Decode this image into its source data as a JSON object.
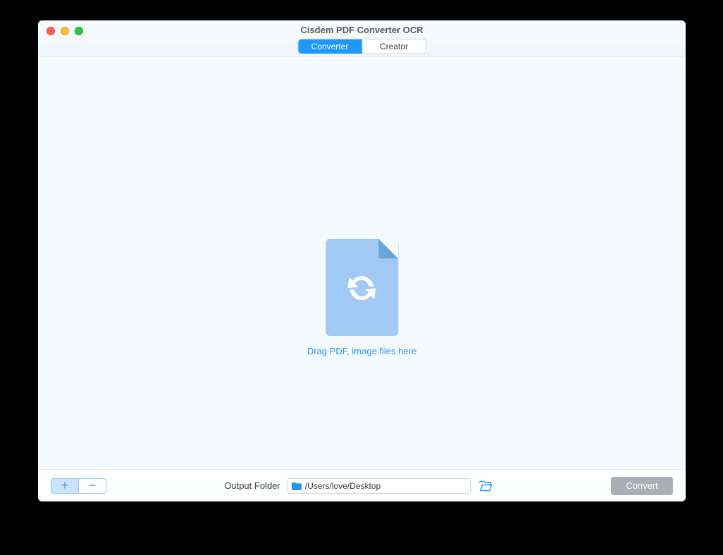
{
  "window": {
    "title": "Cisdem PDF Converter OCR"
  },
  "tabs": {
    "converter": "Converter",
    "creator": "Creator"
  },
  "drop": {
    "hint": "Drag PDF, image files here"
  },
  "footer": {
    "out_label": "Output Folder",
    "out_path": "/Users/love/Desktop",
    "convert": "Convert"
  }
}
